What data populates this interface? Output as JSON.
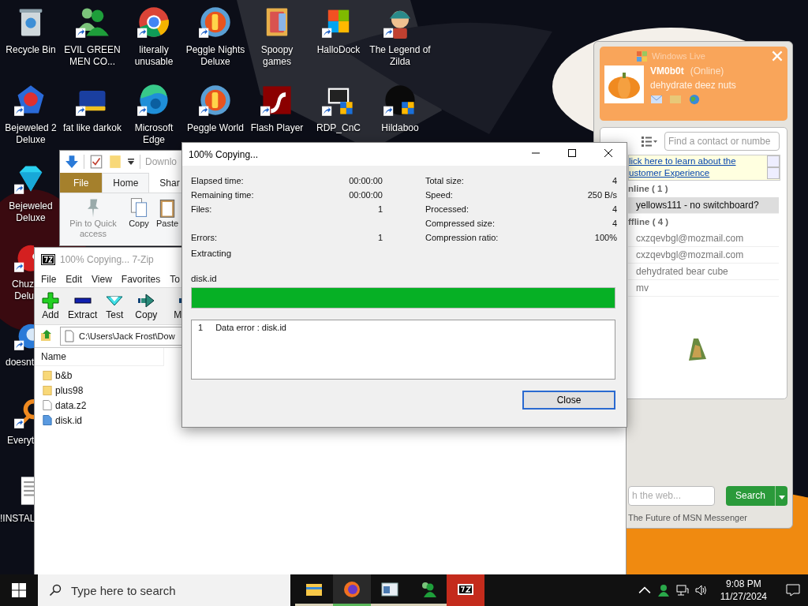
{
  "desktop": {
    "icon_columns": [
      {
        "icons": [
          {
            "label": "Recycle Bin",
            "kind": "bin",
            "shortcut": false,
            "cut": false
          },
          {
            "label": "Bejeweled 2 Deluxe",
            "kind": "gem2",
            "shortcut": true,
            "cut": false
          },
          {
            "label": "Bejeweled Deluxe",
            "kind": "gem",
            "shortcut": true,
            "cut": false
          },
          {
            "label": "Chuz Delu",
            "kind": "redball",
            "shortcut": true,
            "cut": true
          },
          {
            "label": "doesnt",
            "kind": "bird",
            "shortcut": true,
            "cut": true
          },
          {
            "label": "Everyt",
            "kind": "magnifier",
            "shortcut": true,
            "cut": true
          },
          {
            "label": "!INSTAL",
            "kind": "doc",
            "shortcut": false,
            "cut": true
          }
        ]
      },
      {
        "icons": [
          {
            "label": "EVIL GREEN MEN CO...",
            "kind": "people",
            "shortcut": true,
            "cut": false
          },
          {
            "label": "fat like darkok",
            "kind": "mpl",
            "shortcut": true,
            "cut": false
          }
        ]
      },
      {
        "icons": [
          {
            "label": "literally unusable",
            "kind": "chrome",
            "shortcut": true,
            "cut": false
          },
          {
            "label": "Microsoft Edge",
            "kind": "edge",
            "shortcut": true,
            "cut": false
          }
        ]
      },
      {
        "icons": [
          {
            "label": "Peggle Nights Deluxe",
            "kind": "peggle",
            "shortcut": true,
            "cut": false
          },
          {
            "label": "Peggle World",
            "kind": "peggle",
            "shortcut": true,
            "cut": false
          }
        ]
      },
      {
        "icons": [
          {
            "label": "Spoopy games",
            "kind": "folder",
            "shortcut": false,
            "cut": false
          },
          {
            "label": "Flash Player",
            "kind": "flash",
            "shortcut": true,
            "cut": false
          }
        ]
      },
      {
        "icons": [
          {
            "label": "HalloDock",
            "kind": "shield",
            "shortcut": true,
            "cut": false
          },
          {
            "label": "RDP_CnC",
            "kind": "rdp",
            "shortcut": true,
            "cut": false
          }
        ]
      },
      {
        "icons": [
          {
            "label": "The Legend of Zilda",
            "kind": "character",
            "shortcut": true,
            "cut": false
          },
          {
            "label": "Hildaboo",
            "kind": "orb",
            "shortcut": true,
            "cut": false
          }
        ]
      }
    ]
  },
  "explorer": {
    "title": "Downlo",
    "tabs": [
      {
        "label": "File",
        "selected": false,
        "kind": "file"
      },
      {
        "label": "Home",
        "selected": true,
        "kind": "tab"
      },
      {
        "label": "Shar",
        "selected": false,
        "kind": "tab"
      }
    ],
    "ribbon": [
      {
        "label": "Pin to Quick access",
        "kind": "pin",
        "disabled": true
      },
      {
        "label": "Copy",
        "kind": "copy",
        "disabled": false
      },
      {
        "label": "Paste",
        "kind": "paste",
        "disabled": false
      }
    ]
  },
  "messenger": {
    "brand": "Windows Live",
    "user": "VM0b0t",
    "status": "(Online)",
    "message": "dehydrate deez nuts",
    "search": {
      "placeholder": "Find a contact or numbe"
    },
    "banner": [
      "lick here to learn about the",
      "ustomer Experience"
    ],
    "groups": [
      {
        "title": "nline ( 1 )",
        "contacts": [
          {
            "name": "yellows111 - no switchboard?",
            "selected": true
          }
        ]
      },
      {
        "title": "ffline ( 4 )",
        "contacts": [
          {
            "name": "cxzqevbgl@mozmail.com",
            "selected": false
          },
          {
            "name": "cxzqevbgl@mozmail.com",
            "selected": false
          },
          {
            "name": "dehydrated bear cube",
            "selected": false
          },
          {
            "name": "mv",
            "selected": false
          }
        ]
      }
    ],
    "web_search": {
      "placeholder": "h the web...",
      "button": "Search"
    },
    "footer": "The Future of MSN Messenger"
  },
  "sevenzip": {
    "title": "100% Copying... 7-Zip",
    "active": false,
    "menu": [
      "File",
      "Edit",
      "View",
      "Favorites",
      "To"
    ],
    "toolbar": [
      {
        "label": "Add",
        "kind": "add"
      },
      {
        "label": "Extract",
        "kind": "extract"
      },
      {
        "label": "Test",
        "kind": "test"
      },
      {
        "label": "Copy",
        "kind": "copy"
      },
      {
        "label": "M",
        "kind": "move"
      }
    ],
    "path": "C:\\Users\\Jack Frost\\Dow",
    "column": "Name",
    "files": [
      {
        "name": "b&b",
        "kind": "folder"
      },
      {
        "name": "plus98",
        "kind": "folder"
      },
      {
        "name": "data.z2",
        "kind": "file"
      },
      {
        "name": "disk.id",
        "kind": "id"
      }
    ]
  },
  "dialog": {
    "title": "100% Copying...",
    "stats": [
      {
        "left": {
          "label": "Elapsed time:",
          "value": "00:00:00"
        },
        "right": {
          "label": "Total size:",
          "value": "4"
        }
      },
      {
        "left": {
          "label": "Remaining time:",
          "value": "00:00:00"
        },
        "right": {
          "label": "Speed:",
          "value": "250 B/s"
        }
      },
      {
        "left": {
          "label": "Files:",
          "value": "1"
        },
        "right": {
          "label": "Processed:",
          "value": "4"
        }
      },
      {
        "right": {
          "label": "Compressed size:",
          "value": "4"
        }
      },
      {
        "left": {
          "label": "Errors:",
          "value": "1"
        },
        "right": {
          "label": "Compression ratio:",
          "value": "100%"
        }
      }
    ],
    "operation": "Extracting",
    "file": "disk.id",
    "progress": {
      "level": 1
    },
    "messages": [
      {
        "number": "1",
        "text": "Data error : disk.id"
      }
    ],
    "button": "Close"
  },
  "taskbar": {
    "search": {
      "placeholder": "Type here to search"
    },
    "apps": [
      {
        "kind": "folder",
        "active": false,
        "flashing": false
      },
      {
        "kind": "firefox",
        "active": true,
        "flashing": false
      },
      {
        "kind": "window",
        "active": false,
        "flashing": false
      },
      {
        "kind": "people",
        "active": false,
        "flashing": false
      },
      {
        "kind": "sevenzip",
        "active": false,
        "flashing": true
      }
    ],
    "time": "9:08 PM",
    "date": "11/27/2024"
  }
}
